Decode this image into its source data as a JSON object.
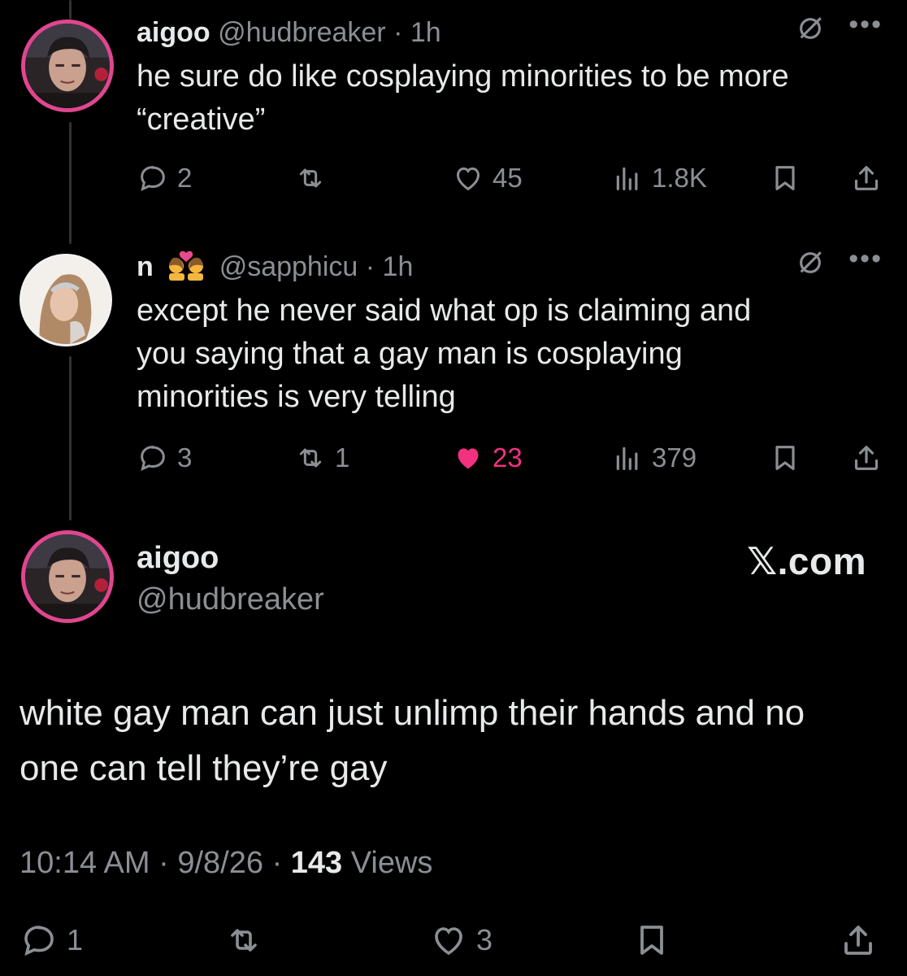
{
  "posts": [
    {
      "name": "aigoo",
      "handle": "@hudbreaker",
      "sep": "·",
      "time": "1h",
      "text_lines": [
        "he sure do like cosplaying minorities to be more",
        "“creative”"
      ],
      "replies": "2",
      "reposts": "",
      "likes": "45",
      "views": "1.8K",
      "liked": false
    },
    {
      "name": "n",
      "handle": "@sapphicu",
      "sep": "·",
      "time": "1h",
      "text_lines": [
        "except he never said what op is claiming and",
        "you saying that a gay man is cosplaying",
        "minorities is very telling"
      ],
      "replies": "3",
      "reposts": "1",
      "likes": "23",
      "views": "379",
      "liked": true
    }
  ],
  "main": {
    "name": "aigoo",
    "handle": "@hudbreaker",
    "brand": "𝕏.com",
    "text_lines": [
      "white gay man can just unlimp their hands and no",
      "one can tell they’re gay"
    ],
    "time": "10:14 AM",
    "sep": "·",
    "date": "9/8/26",
    "views_count": "143",
    "views_label": "Views",
    "replies": "1",
    "likes": "3"
  },
  "icons": {
    "reply": "speech-bubble-icon",
    "repost": "repost-arrows-icon",
    "like": "heart-icon",
    "views": "bar-chart-icon",
    "bookmark": "bookmark-icon",
    "share": "share-upload-icon",
    "grok": "slashed-circle-icon",
    "more": "ellipsis-icon"
  },
  "colors": {
    "background": "#000000",
    "text": "#e7e9ea",
    "secondary": "#8b8f94",
    "like_active": "#f2317f",
    "avatar_ring": "#e0468f"
  }
}
